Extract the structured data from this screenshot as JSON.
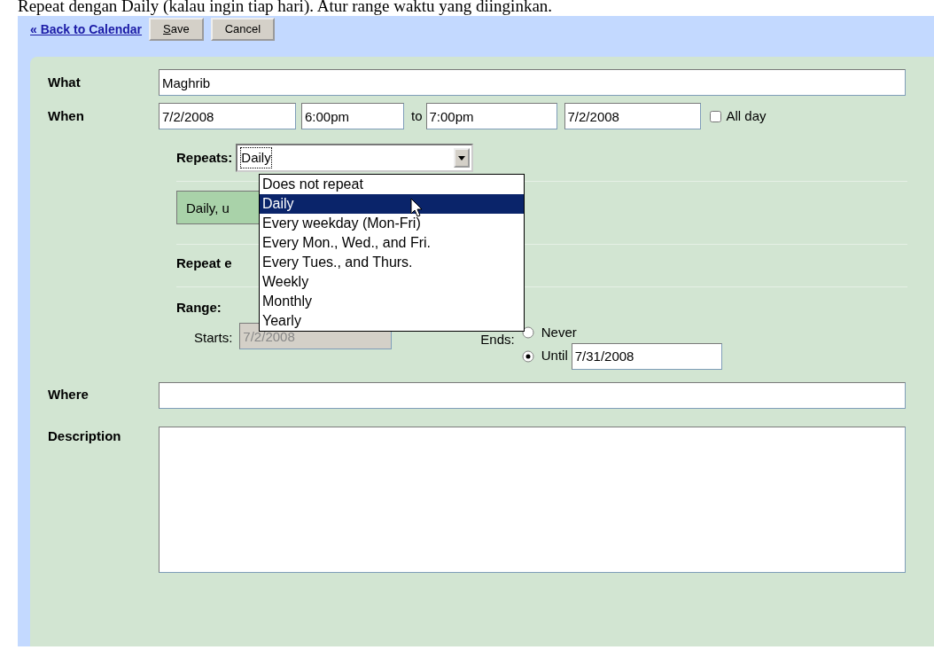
{
  "caption": "Repeat dengan Daily (kalau ingin tiap hari). Atur range waktu yang diinginkan.",
  "toolbar": {
    "back_link": "« Back to Calendar",
    "buttons": [
      {
        "label": "Save",
        "underline_first": true
      },
      {
        "label": "Cancel",
        "underline_first": false
      }
    ]
  },
  "what": {
    "label": "What",
    "value": "Maghrib"
  },
  "when": {
    "label": "When",
    "start_date": "7/2/2008",
    "start_time": "6:00pm",
    "to": "to",
    "end_time": "7:00pm",
    "end_date": "7/2/2008",
    "all_day": {
      "label": "All day",
      "checked": false
    }
  },
  "repeats": {
    "label": "Repeats:",
    "value": "Daily",
    "expanded": true,
    "options": [
      {
        "label": "Does not repeat",
        "selected": false
      },
      {
        "label": "Daily",
        "selected": true
      },
      {
        "label": "Every weekday (Mon-Fri)",
        "selected": false
      },
      {
        "label": "Every Mon., Wed., and Fri.",
        "selected": false
      },
      {
        "label": "Every Tues., and Thurs.",
        "selected": false
      },
      {
        "label": "Weekly",
        "selected": false
      },
      {
        "label": "Monthly",
        "selected": false
      },
      {
        "label": "Yearly",
        "selected": false
      }
    ]
  },
  "summary": "Daily, u",
  "repeat_every_label": "Repeat e",
  "range": {
    "label": "Range:",
    "starts_label": "Starts:",
    "starts_value": "7/2/2008",
    "starts_disabled": true,
    "ends_label": "Ends:",
    "ends_options": [
      {
        "label": "Never",
        "selected": false
      },
      {
        "label": "Until",
        "selected": true,
        "value": "7/31/2008"
      }
    ]
  },
  "where": {
    "label": "Where"
  },
  "description": {
    "label": "Description"
  }
}
